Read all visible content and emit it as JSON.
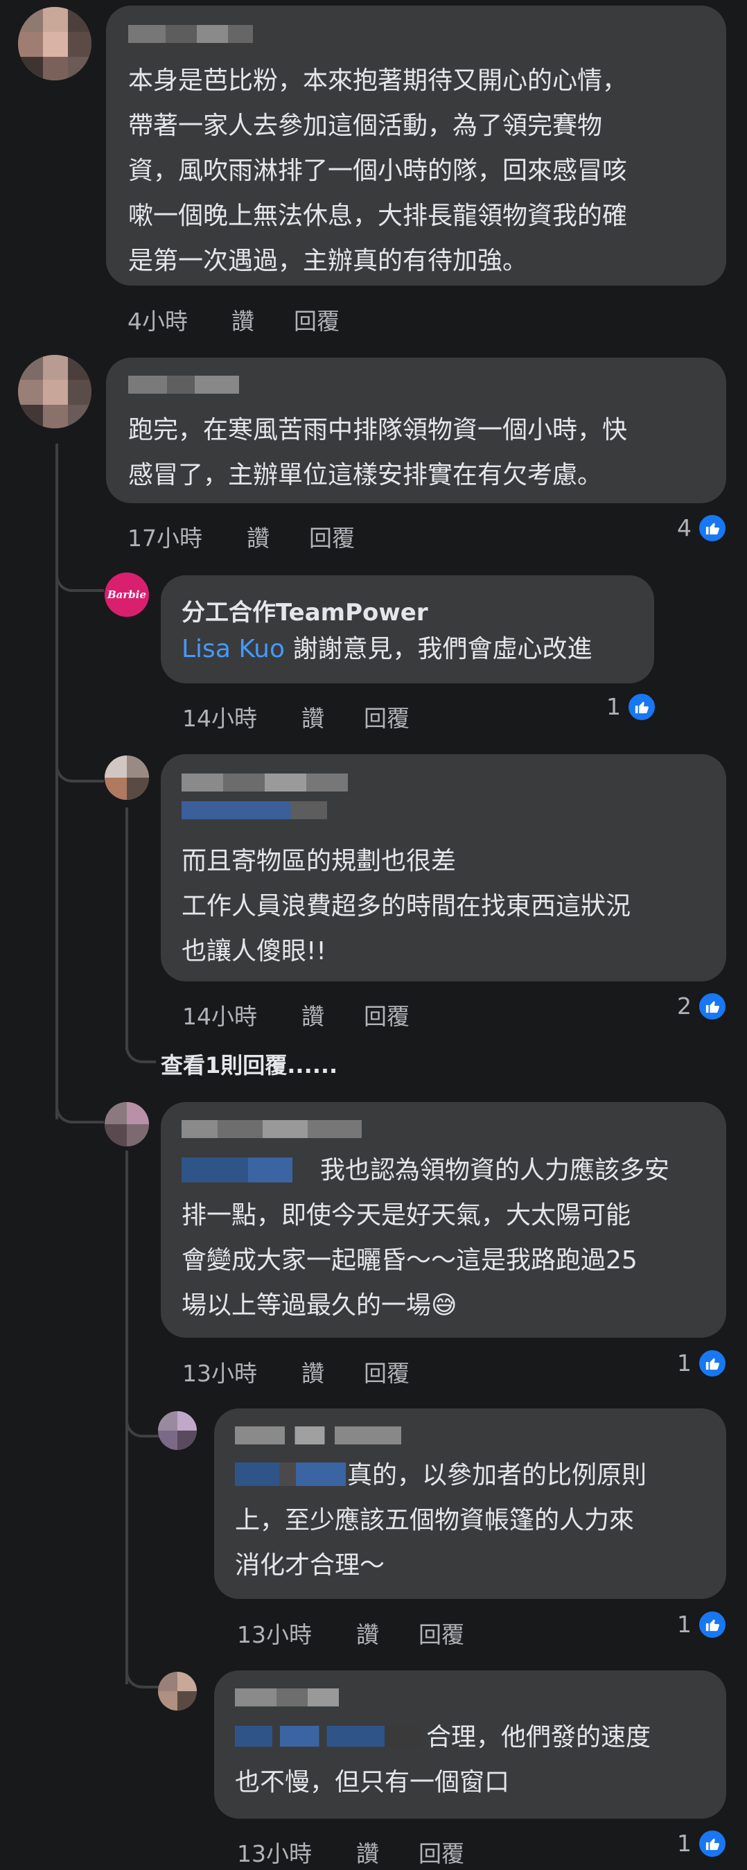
{
  "colors": {
    "background": "#18191a",
    "bubble": "#3a3b3c",
    "like": "#1877f2",
    "link": "#4599ff",
    "meta": "#b0b3b8"
  },
  "comments": [
    {
      "body": [
        "本身是芭比粉，本來抱著期待又開心的心情，",
        "帶著一家人去參加這個活動，為了領完賽物",
        "資，風吹雨淋排了一個小時的隊，回來感冒咳",
        "嗽一個晚上無法休息，大排長龍領物資我的確",
        "是第一次遇過，主辦真的有待加強。"
      ],
      "time": "4小時",
      "like": "讚",
      "reply": "回覆"
    },
    {
      "body": [
        "跑完，在寒風苦雨中排隊領物資一個小時，快",
        "感冒了，主辦單位這樣安排實在有欠考慮。"
      ],
      "time": "17小時",
      "like": "讚",
      "reply": "回覆",
      "like_count": "4"
    }
  ],
  "replies": [
    {
      "author": "分工合作TeamPower",
      "avatar_text": "Barbie",
      "mention": "Lisa Kuo",
      "body": [
        "謝謝意見，我們會虛心改進"
      ],
      "time": "14小時",
      "like": "讚",
      "reply": "回覆",
      "like_count": "1"
    },
    {
      "body": [
        "而且寄物區的規劃也很差",
        "工作人員浪費超多的時間在找東西這狀況",
        "也讓人傻眼!!"
      ],
      "time": "14小時",
      "like": "讚",
      "reply": "回覆",
      "like_count": "2",
      "view_more": "查看1則回覆......"
    },
    {
      "body": [
        "我也認為領物資的人力應該多安",
        "排一點，即使今天是好天氣，大太陽可能",
        "會變成大家一起曬昏～～這是我路跑過25",
        "場以上等過最久的一場😅"
      ],
      "time": "13小時",
      "like": "讚",
      "reply": "回覆",
      "like_count": "1"
    },
    {
      "body": [
        "真的，以參加者的比例原則",
        "上，至少應該五個物資帳篷的人力來",
        "消化才合理～"
      ],
      "time": "13小時",
      "like": "讚",
      "reply": "回覆",
      "like_count": "1"
    },
    {
      "body": [
        "合理，他們發的速度",
        "也不慢，但只有一個窗口"
      ],
      "time": "13小時",
      "like": "讚",
      "reply": "回覆",
      "like_count": "1"
    }
  ]
}
